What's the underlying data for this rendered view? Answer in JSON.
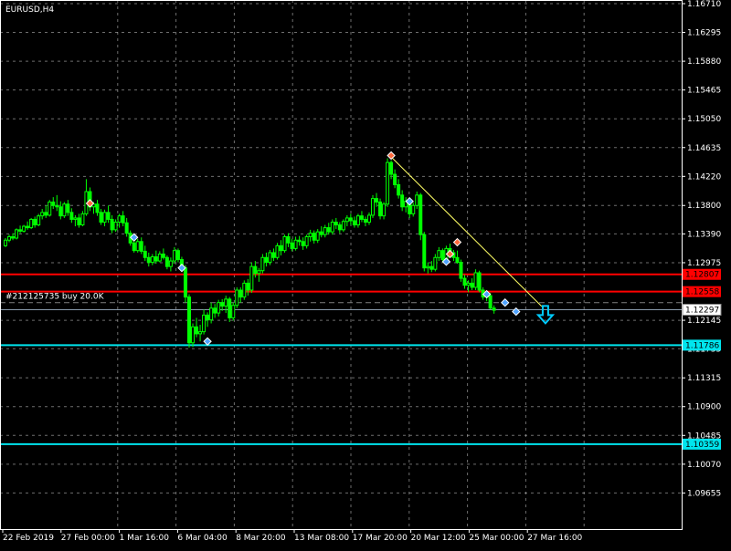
{
  "window": {
    "symbol_title": "EURUSD,H4"
  },
  "chart_data": {
    "type": "candlestick",
    "symbol": "EURUSD",
    "timeframe": "H4",
    "ylim": [
      1.09555,
      1.1671
    ],
    "y_ticks": [
      "1.16710",
      "1.16295",
      "1.15880",
      "1.15465",
      "1.15050",
      "1.14635",
      "1.14220",
      "1.13800",
      "1.13390",
      "1.12975",
      "1.12560",
      "1.12145",
      "1.11735",
      "1.11315",
      "1.10900",
      "1.10485",
      "1.10070",
      "1.09655"
    ],
    "x_ticks": [
      "22 Feb 2019",
      "27 Feb 00:00",
      "1 Mar 16:00",
      "6 Mar 04:00",
      "8 Mar 20:00",
      "13 Mar 08:00",
      "17 Mar 20:00",
      "20 Mar 12:00",
      "25 Mar 00:00",
      "27 Mar 16:00"
    ],
    "current_price": {
      "label": "1.12297",
      "value": 1.12297
    },
    "horizontal_lines": [
      {
        "label": "1.12807",
        "value": 1.12807,
        "color": "#ff0000"
      },
      {
        "label": "1.12558",
        "value": 1.12558,
        "color": "#ff0000"
      },
      {
        "label": "1.11786",
        "value": 1.11786,
        "color": "#00e5ee"
      },
      {
        "label": "1.10359",
        "value": 1.10359,
        "color": "#00e5ee"
      }
    ],
    "order_line": {
      "label": "#212125735 buy 20.0K",
      "value": 1.124
    },
    "candles": [
      [
        1.1322,
        1.1333,
        1.132,
        1.133
      ],
      [
        1.133,
        1.1338,
        1.1327,
        1.1335
      ],
      [
        1.1335,
        1.134,
        1.133,
        1.1333
      ],
      [
        1.1333,
        1.1347,
        1.1331,
        1.1345
      ],
      [
        1.1345,
        1.1351,
        1.134,
        1.1343
      ],
      [
        1.1343,
        1.1352,
        1.1341,
        1.135
      ],
      [
        1.135,
        1.1357,
        1.1345,
        1.1348
      ],
      [
        1.1348,
        1.1362,
        1.1346,
        1.136
      ],
      [
        1.136,
        1.1364,
        1.1348,
        1.1352
      ],
      [
        1.1352,
        1.1368,
        1.135,
        1.1365
      ],
      [
        1.1365,
        1.1375,
        1.136,
        1.137
      ],
      [
        1.137,
        1.138,
        1.1362,
        1.1366
      ],
      [
        1.1366,
        1.1388,
        1.1364,
        1.1385
      ],
      [
        1.1385,
        1.1392,
        1.1375,
        1.138
      ],
      [
        1.138,
        1.1395,
        1.1372,
        1.1378
      ],
      [
        1.1378,
        1.1386,
        1.136,
        1.1365
      ],
      [
        1.1365,
        1.1385,
        1.1362,
        1.1382
      ],
      [
        1.1382,
        1.1388,
        1.1365,
        1.137
      ],
      [
        1.137,
        1.1376,
        1.1355,
        1.136
      ],
      [
        1.136,
        1.1366,
        1.135,
        1.1362
      ],
      [
        1.1362,
        1.1368,
        1.1348,
        1.1352
      ],
      [
        1.1352,
        1.1372,
        1.135,
        1.1368
      ],
      [
        1.1368,
        1.1418,
        1.1365,
        1.14
      ],
      [
        1.14,
        1.1406,
        1.1372,
        1.1378
      ],
      [
        1.1378,
        1.1385,
        1.1368,
        1.1382
      ],
      [
        1.1382,
        1.1388,
        1.1365,
        1.137
      ],
      [
        1.137,
        1.1375,
        1.1352,
        1.1356
      ],
      [
        1.1356,
        1.1374,
        1.135,
        1.137
      ],
      [
        1.137,
        1.138,
        1.1355,
        1.136
      ],
      [
        1.136,
        1.1366,
        1.134,
        1.1345
      ],
      [
        1.1345,
        1.136,
        1.1342,
        1.1356
      ],
      [
        1.1356,
        1.1368,
        1.1348,
        1.1365
      ],
      [
        1.1365,
        1.1372,
        1.135,
        1.1355
      ],
      [
        1.1355,
        1.1362,
        1.1335,
        1.134
      ],
      [
        1.134,
        1.1344,
        1.1322,
        1.1326
      ],
      [
        1.1326,
        1.133,
        1.1312,
        1.1315
      ],
      [
        1.1315,
        1.1332,
        1.1312,
        1.1328
      ],
      [
        1.1328,
        1.1334,
        1.131,
        1.1314
      ],
      [
        1.1314,
        1.1322,
        1.13,
        1.1305
      ],
      [
        1.1305,
        1.1312,
        1.1292,
        1.1298
      ],
      [
        1.1298,
        1.131,
        1.1294,
        1.1306
      ],
      [
        1.1306,
        1.1315,
        1.1296,
        1.13
      ],
      [
        1.13,
        1.1314,
        1.1298,
        1.131
      ],
      [
        1.131,
        1.1318,
        1.1302,
        1.1305
      ],
      [
        1.1305,
        1.1308,
        1.1288,
        1.1292
      ],
      [
        1.1292,
        1.1305,
        1.1285,
        1.13
      ],
      [
        1.13,
        1.132,
        1.1296,
        1.1315
      ],
      [
        1.1315,
        1.1318,
        1.1298,
        1.1302
      ],
      [
        1.1302,
        1.1306,
        1.1285,
        1.129
      ],
      [
        1.129,
        1.1294,
        1.124,
        1.1248
      ],
      [
        1.1248,
        1.1252,
        1.1175,
        1.1182
      ],
      [
        1.1182,
        1.121,
        1.1176,
        1.1205
      ],
      [
        1.1205,
        1.1218,
        1.119,
        1.1195
      ],
      [
        1.1195,
        1.1208,
        1.1184,
        1.1198
      ],
      [
        1.1198,
        1.123,
        1.1194,
        1.1222
      ],
      [
        1.1222,
        1.1226,
        1.1205,
        1.1215
      ],
      [
        1.1215,
        1.124,
        1.121,
        1.1232
      ],
      [
        1.1232,
        1.1238,
        1.1218,
        1.1225
      ],
      [
        1.1225,
        1.1244,
        1.122,
        1.124
      ],
      [
        1.124,
        1.1245,
        1.1228,
        1.1235
      ],
      [
        1.1235,
        1.125,
        1.1225,
        1.1245
      ],
      [
        1.1245,
        1.1248,
        1.1212,
        1.1218
      ],
      [
        1.1218,
        1.124,
        1.1214,
        1.1236
      ],
      [
        1.1236,
        1.1262,
        1.1232,
        1.1258
      ],
      [
        1.1258,
        1.1262,
        1.124,
        1.1248
      ],
      [
        1.1248,
        1.1272,
        1.1244,
        1.1268
      ],
      [
        1.1268,
        1.1274,
        1.125,
        1.1258
      ],
      [
        1.1258,
        1.1298,
        1.1254,
        1.1292
      ],
      [
        1.1292,
        1.13,
        1.1276,
        1.1282
      ],
      [
        1.1282,
        1.129,
        1.127,
        1.1286
      ],
      [
        1.1286,
        1.131,
        1.1282,
        1.1305
      ],
      [
        1.1305,
        1.1312,
        1.1292,
        1.1298
      ],
      [
        1.1298,
        1.1316,
        1.1294,
        1.1312
      ],
      [
        1.1312,
        1.1318,
        1.13,
        1.1305
      ],
      [
        1.1305,
        1.1326,
        1.1302,
        1.1322
      ],
      [
        1.1322,
        1.133,
        1.1308,
        1.1315
      ],
      [
        1.1315,
        1.1338,
        1.1312,
        1.1335
      ],
      [
        1.1335,
        1.134,
        1.132,
        1.1326
      ],
      [
        1.1326,
        1.1332,
        1.1314,
        1.1318
      ],
      [
        1.1318,
        1.1335,
        1.1315,
        1.133
      ],
      [
        1.133,
        1.1336,
        1.1322,
        1.1328
      ],
      [
        1.1328,
        1.1334,
        1.1316,
        1.1322
      ],
      [
        1.1322,
        1.1338,
        1.1318,
        1.1335
      ],
      [
        1.1335,
        1.1345,
        1.1328,
        1.134
      ],
      [
        1.134,
        1.1344,
        1.1325,
        1.133
      ],
      [
        1.133,
        1.1346,
        1.1326,
        1.1342
      ],
      [
        1.1342,
        1.135,
        1.1334,
        1.1338
      ],
      [
        1.1338,
        1.1352,
        1.1334,
        1.1348
      ],
      [
        1.1348,
        1.1355,
        1.1338,
        1.1342
      ],
      [
        1.1342,
        1.136,
        1.1338,
        1.1356
      ],
      [
        1.1356,
        1.1362,
        1.1346,
        1.1352
      ],
      [
        1.1352,
        1.1356,
        1.134,
        1.1345
      ],
      [
        1.1345,
        1.136,
        1.1342,
        1.1357
      ],
      [
        1.1357,
        1.1366,
        1.135,
        1.1362
      ],
      [
        1.1362,
        1.1368,
        1.1352,
        1.1358
      ],
      [
        1.1358,
        1.1364,
        1.1348,
        1.1352
      ],
      [
        1.1352,
        1.1368,
        1.1348,
        1.1365
      ],
      [
        1.1365,
        1.1372,
        1.1356,
        1.136
      ],
      [
        1.136,
        1.1364,
        1.135,
        1.1356
      ],
      [
        1.1356,
        1.137,
        1.1352,
        1.1366
      ],
      [
        1.1366,
        1.1395,
        1.1362,
        1.139
      ],
      [
        1.139,
        1.1398,
        1.1378,
        1.1385
      ],
      [
        1.1385,
        1.139,
        1.136,
        1.1365
      ],
      [
        1.1365,
        1.1385,
        1.136,
        1.1382
      ],
      [
        1.1382,
        1.1448,
        1.1378,
        1.1442
      ],
      [
        1.1442,
        1.1445,
        1.1418,
        1.1425
      ],
      [
        1.1425,
        1.1432,
        1.1405,
        1.141
      ],
      [
        1.141,
        1.1418,
        1.139,
        1.1395
      ],
      [
        1.1395,
        1.1402,
        1.1372,
        1.1378
      ],
      [
        1.1378,
        1.1392,
        1.137,
        1.1386
      ],
      [
        1.1386,
        1.139,
        1.1362,
        1.1368
      ],
      [
        1.1368,
        1.1384,
        1.1364,
        1.138
      ],
      [
        1.138,
        1.14,
        1.1375,
        1.1395
      ],
      [
        1.1395,
        1.1398,
        1.133,
        1.1338
      ],
      [
        1.1338,
        1.1342,
        1.1285,
        1.129
      ],
      [
        1.129,
        1.1298,
        1.1282,
        1.1292
      ],
      [
        1.1292,
        1.13,
        1.1284,
        1.1288
      ],
      [
        1.1288,
        1.131,
        1.1285,
        1.1305
      ],
      [
        1.1305,
        1.132,
        1.13,
        1.1315
      ],
      [
        1.1315,
        1.1318,
        1.1298,
        1.1302
      ],
      [
        1.1302,
        1.1322,
        1.1298,
        1.1318
      ],
      [
        1.1318,
        1.1325,
        1.1308,
        1.1312
      ],
      [
        1.1312,
        1.1316,
        1.13,
        1.1305
      ],
      [
        1.1305,
        1.1315,
        1.1296,
        1.1298
      ],
      [
        1.1298,
        1.1302,
        1.127,
        1.1275
      ],
      [
        1.1275,
        1.128,
        1.126,
        1.1265
      ],
      [
        1.1265,
        1.1272,
        1.1255,
        1.1268
      ],
      [
        1.1268,
        1.1275,
        1.1258,
        1.1262
      ],
      [
        1.1262,
        1.1288,
        1.1258,
        1.1283
      ],
      [
        1.1283,
        1.1286,
        1.1255,
        1.1258
      ],
      [
        1.1258,
        1.1262,
        1.1244,
        1.1248
      ],
      [
        1.1248,
        1.1255,
        1.1242,
        1.125
      ],
      [
        1.125,
        1.1254,
        1.123,
        1.1232
      ],
      [
        1.1232,
        1.1236,
        1.1224,
        1.1229
      ]
    ],
    "markers": [
      {
        "type": "sell",
        "candle": 23,
        "price": 1.1383
      },
      {
        "type": "buy",
        "candle": 35,
        "price": 1.1334
      },
      {
        "type": "buy",
        "candle": 48,
        "price": 1.129
      },
      {
        "type": "buy",
        "candle": 55,
        "price": 1.1184
      },
      {
        "type": "sell",
        "candle": 105,
        "price": 1.1452
      },
      {
        "type": "buy",
        "candle": 110,
        "price": 1.1386
      },
      {
        "type": "buy",
        "candle": 120,
        "price": 1.1299
      },
      {
        "type": "sell",
        "candle": 121,
        "price": 1.131
      },
      {
        "type": "sell",
        "candle": 123,
        "price": 1.1327
      },
      {
        "type": "buy",
        "candle": 131,
        "price": 1.1252
      },
      {
        "type": "buy",
        "candle": 136,
        "price": 1.124
      },
      {
        "type": "buy",
        "candle": 139,
        "price": 1.1227
      }
    ],
    "trendline": {
      "from": {
        "candle": 105,
        "price": 1.145
      },
      "to": {
        "candle": 143,
        "price": 1.1245
      }
    },
    "signal_arrow": {
      "direction": "down",
      "candle": 147,
      "price": 1.1222
    },
    "colors": {
      "background": "#000000",
      "bull_candle": "#00ff00",
      "bear_candle": "#00ff00",
      "grid": "#c8c8c8",
      "axis": "#ffffff",
      "text": "#ffffff",
      "trendline": "#ffff66",
      "signal_arrow": "#00ccff",
      "buy_marker": "#4fa3ff",
      "sell_marker": "#ff6a3d",
      "current_price_line": "#8899aa",
      "order_line": "#808080"
    }
  }
}
